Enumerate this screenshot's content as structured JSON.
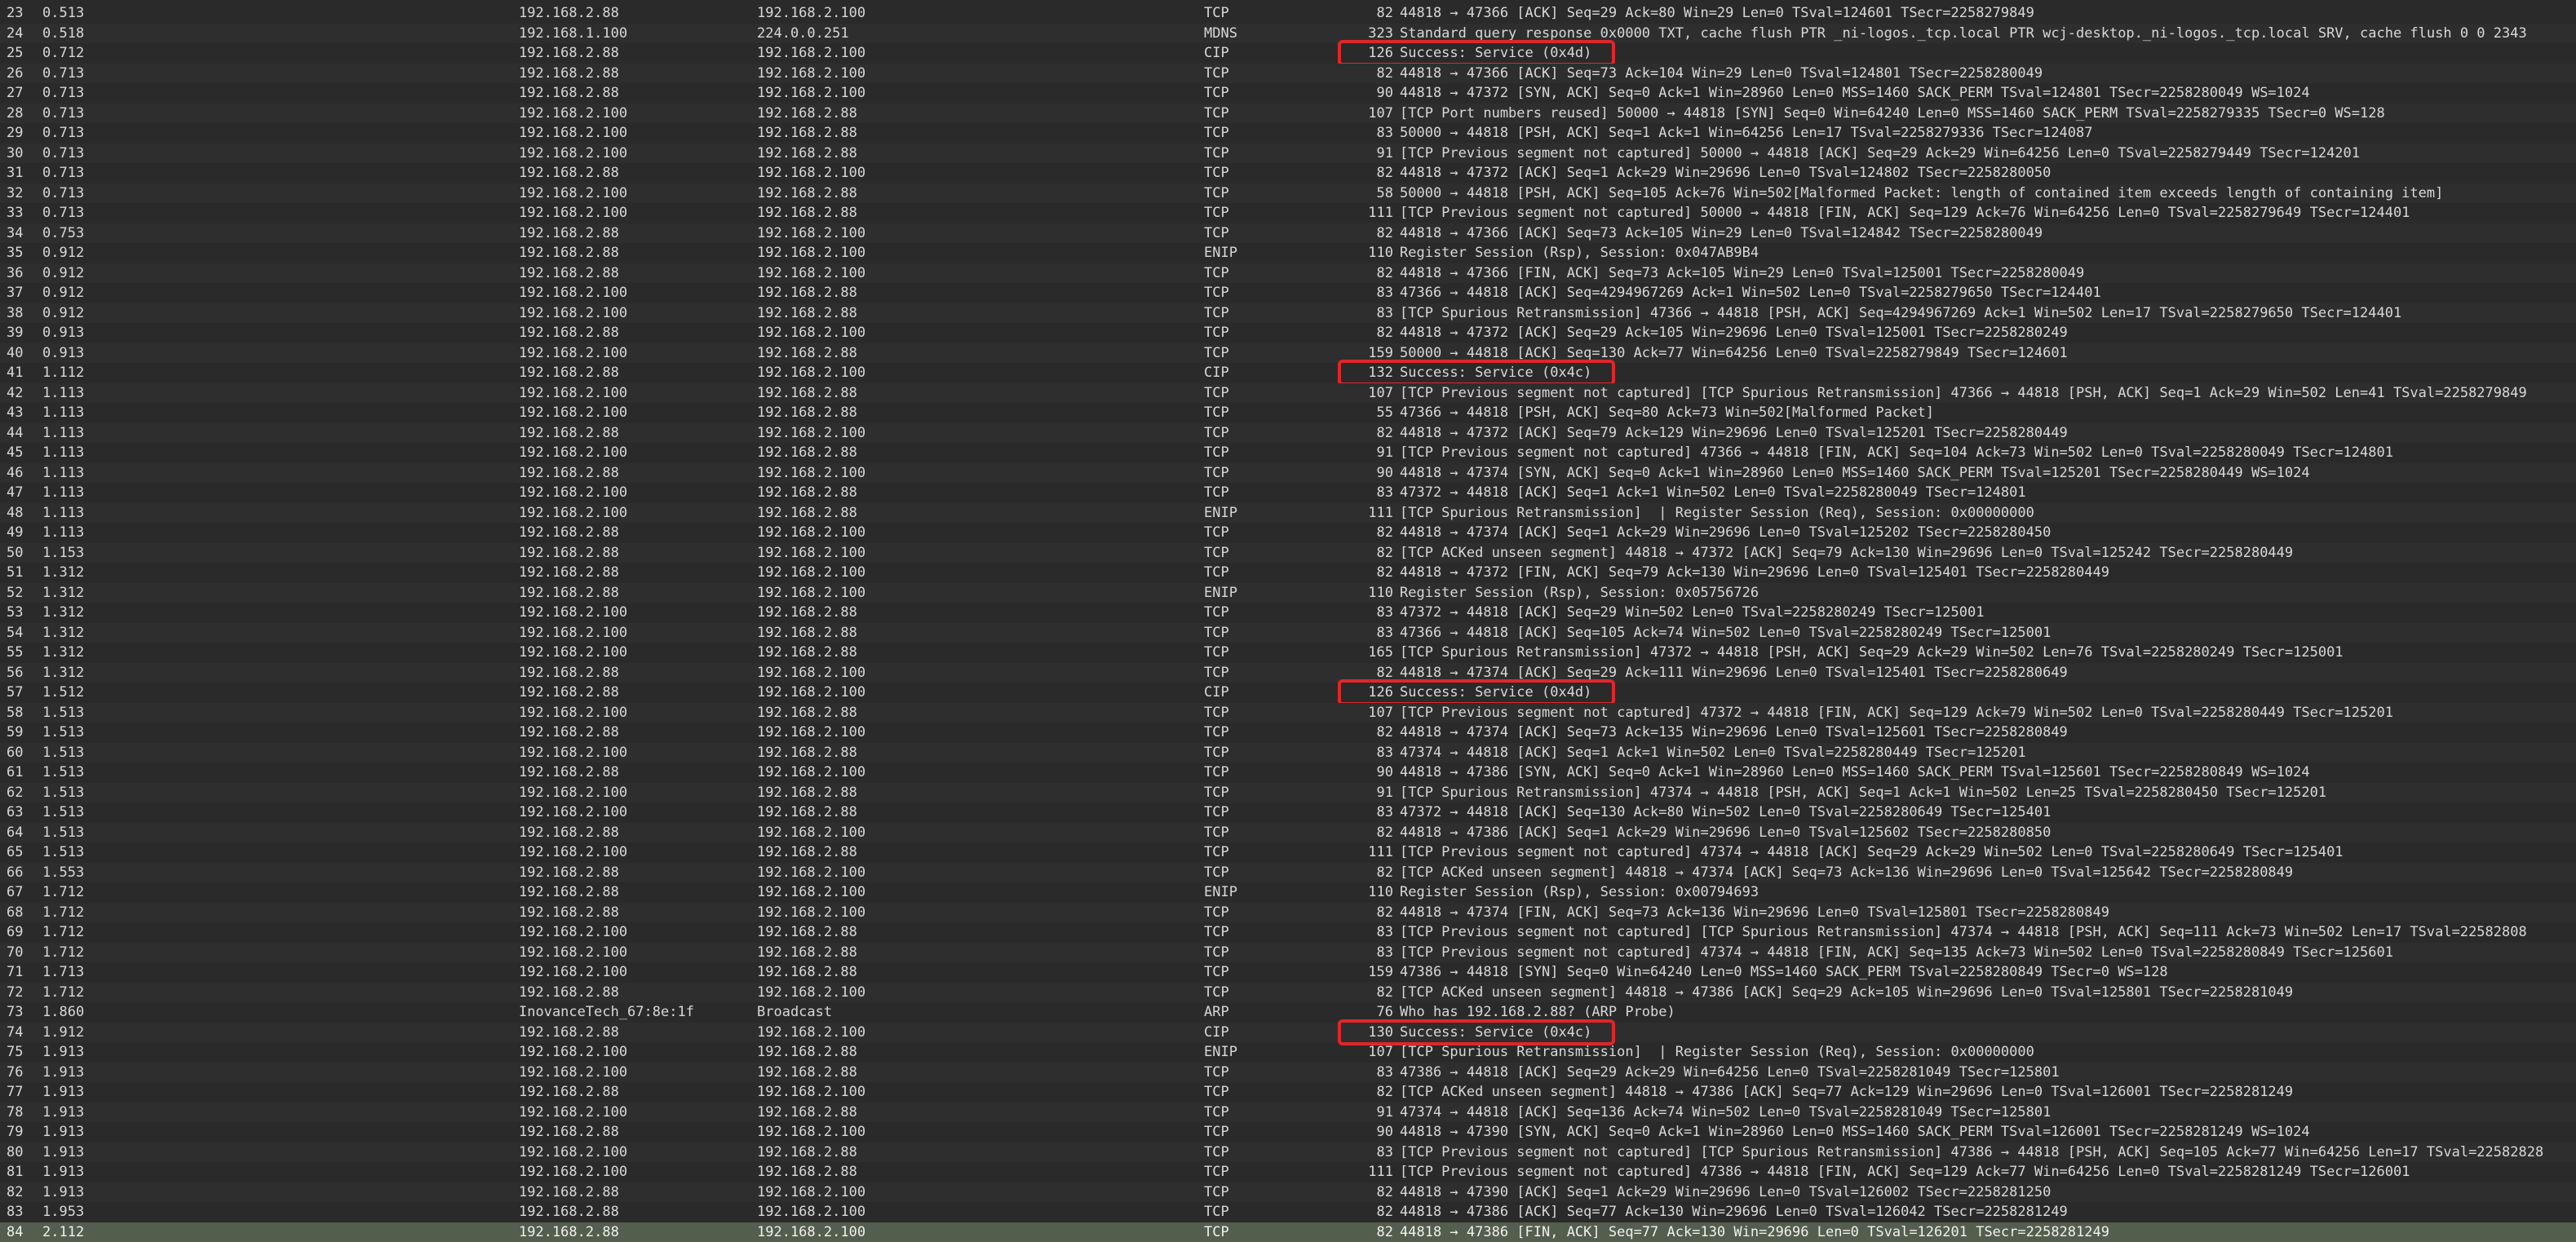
{
  "packets": [
    {
      "no": "23",
      "time": "0.513",
      "src": "192.168.2.88",
      "dst": "192.168.2.100",
      "proto": "TCP",
      "len": "82",
      "info": "44818 → 47366 [ACK] Seq=29 Ack=80 Win=29 Len=0 TSval=124601 TSecr=2258279849"
    },
    {
      "no": "24",
      "time": "0.518",
      "src": "192.168.1.100",
      "dst": "224.0.0.251",
      "proto": "MDNS",
      "len": "323",
      "info": "Standard query response 0x0000 TXT, cache flush PTR _ni-logos._tcp.local PTR wcj-desktop._ni-logos._tcp.local SRV, cache flush 0 0 2343"
    },
    {
      "no": "25",
      "time": "0.712",
      "src": "192.168.2.88",
      "dst": "192.168.2.100",
      "proto": "CIP",
      "len": "126",
      "info": "Success: Service (0x4d)"
    },
    {
      "no": "26",
      "time": "0.713",
      "src": "192.168.2.88",
      "dst": "192.168.2.100",
      "proto": "TCP",
      "len": "82",
      "info": "44818 → 47366 [ACK] Seq=73 Ack=104 Win=29 Len=0 TSval=124801 TSecr=2258280049"
    },
    {
      "no": "27",
      "time": "0.713",
      "src": "192.168.2.88",
      "dst": "192.168.2.100",
      "proto": "TCP",
      "len": "90",
      "info": "44818 → 47372 [SYN, ACK] Seq=0 Ack=1 Win=28960 Len=0 MSS=1460 SACK_PERM TSval=124801 TSecr=2258280049 WS=1024"
    },
    {
      "no": "28",
      "time": "0.713",
      "src": "192.168.2.100",
      "dst": "192.168.2.88",
      "proto": "TCP",
      "len": "107",
      "info": "[TCP Port numbers reused] 50000 → 44818 [SYN] Seq=0 Win=64240 Len=0 MSS=1460 SACK_PERM TSval=2258279335 TSecr=0 WS=128"
    },
    {
      "no": "29",
      "time": "0.713",
      "src": "192.168.2.100",
      "dst": "192.168.2.88",
      "proto": "TCP",
      "len": "83",
      "info": "50000 → 44818 [PSH, ACK] Seq=1 Ack=1 Win=64256 Len=17 TSval=2258279336 TSecr=124087"
    },
    {
      "no": "30",
      "time": "0.713",
      "src": "192.168.2.100",
      "dst": "192.168.2.88",
      "proto": "TCP",
      "len": "91",
      "info": "[TCP Previous segment not captured] 50000 → 44818 [ACK] Seq=29 Ack=29 Win=64256 Len=0 TSval=2258279449 TSecr=124201"
    },
    {
      "no": "31",
      "time": "0.713",
      "src": "192.168.2.88",
      "dst": "192.168.2.100",
      "proto": "TCP",
      "len": "82",
      "info": "44818 → 47372 [ACK] Seq=1 Ack=29 Win=29696 Len=0 TSval=124802 TSecr=2258280050"
    },
    {
      "no": "32",
      "time": "0.713",
      "src": "192.168.2.100",
      "dst": "192.168.2.88",
      "proto": "TCP",
      "len": "58",
      "info": "50000 → 44818 [PSH, ACK] Seq=105 Ack=76 Win=502[Malformed Packet: length of contained item exceeds length of containing item]"
    },
    {
      "no": "33",
      "time": "0.713",
      "src": "192.168.2.100",
      "dst": "192.168.2.88",
      "proto": "TCP",
      "len": "111",
      "info": "[TCP Previous segment not captured] 50000 → 44818 [FIN, ACK] Seq=129 Ack=76 Win=64256 Len=0 TSval=2258279649 TSecr=124401"
    },
    {
      "no": "34",
      "time": "0.753",
      "src": "192.168.2.88",
      "dst": "192.168.2.100",
      "proto": "TCP",
      "len": "82",
      "info": "44818 → 47366 [ACK] Seq=73 Ack=105 Win=29 Len=0 TSval=124842 TSecr=2258280049"
    },
    {
      "no": "35",
      "time": "0.912",
      "src": "192.168.2.88",
      "dst": "192.168.2.100",
      "proto": "ENIP",
      "len": "110",
      "info": "Register Session (Rsp), Session: 0x047AB9B4"
    },
    {
      "no": "36",
      "time": "0.912",
      "src": "192.168.2.88",
      "dst": "192.168.2.100",
      "proto": "TCP",
      "len": "82",
      "info": "44818 → 47366 [FIN, ACK] Seq=73 Ack=105 Win=29 Len=0 TSval=125001 TSecr=2258280049"
    },
    {
      "no": "37",
      "time": "0.912",
      "src": "192.168.2.100",
      "dst": "192.168.2.88",
      "proto": "TCP",
      "len": "83",
      "info": "47366 → 44818 [ACK] Seq=4294967269 Ack=1 Win=502 Len=0 TSval=2258279650 TSecr=124401"
    },
    {
      "no": "38",
      "time": "0.912",
      "src": "192.168.2.100",
      "dst": "192.168.2.88",
      "proto": "TCP",
      "len": "83",
      "info": "[TCP Spurious Retransmission] 47366 → 44818 [PSH, ACK] Seq=4294967269 Ack=1 Win=502 Len=17 TSval=2258279650 TSecr=124401"
    },
    {
      "no": "39",
      "time": "0.913",
      "src": "192.168.2.88",
      "dst": "192.168.2.100",
      "proto": "TCP",
      "len": "82",
      "info": "44818 → 47372 [ACK] Seq=29 Ack=105 Win=29696 Len=0 TSval=125001 TSecr=2258280249"
    },
    {
      "no": "40",
      "time": "0.913",
      "src": "192.168.2.100",
      "dst": "192.168.2.88",
      "proto": "TCP",
      "len": "159",
      "info": "50000 → 44818 [ACK] Seq=130 Ack=77 Win=64256 Len=0 TSval=2258279849 TSecr=124601"
    },
    {
      "no": "41",
      "time": "1.112",
      "src": "192.168.2.88",
      "dst": "192.168.2.100",
      "proto": "CIP",
      "len": "132",
      "info": "Success: Service (0x4c)"
    },
    {
      "no": "42",
      "time": "1.113",
      "src": "192.168.2.100",
      "dst": "192.168.2.88",
      "proto": "TCP",
      "len": "107",
      "info": "[TCP Previous segment not captured] [TCP Spurious Retransmission] 47366 → 44818 [PSH, ACK] Seq=1 Ack=29 Win=502 Len=41 TSval=2258279849"
    },
    {
      "no": "43",
      "time": "1.113",
      "src": "192.168.2.100",
      "dst": "192.168.2.88",
      "proto": "TCP",
      "len": "55",
      "info": "47366 → 44818 [PSH, ACK] Seq=80 Ack=73 Win=502[Malformed Packet]"
    },
    {
      "no": "44",
      "time": "1.113",
      "src": "192.168.2.88",
      "dst": "192.168.2.100",
      "proto": "TCP",
      "len": "82",
      "info": "44818 → 47372 [ACK] Seq=79 Ack=129 Win=29696 Len=0 TSval=125201 TSecr=2258280449"
    },
    {
      "no": "45",
      "time": "1.113",
      "src": "192.168.2.100",
      "dst": "192.168.2.88",
      "proto": "TCP",
      "len": "91",
      "info": "[TCP Previous segment not captured] 47366 → 44818 [FIN, ACK] Seq=104 Ack=73 Win=502 Len=0 TSval=2258280049 TSecr=124801"
    },
    {
      "no": "46",
      "time": "1.113",
      "src": "192.168.2.88",
      "dst": "192.168.2.100",
      "proto": "TCP",
      "len": "90",
      "info": "44818 → 47374 [SYN, ACK] Seq=0 Ack=1 Win=28960 Len=0 MSS=1460 SACK_PERM TSval=125201 TSecr=2258280449 WS=1024"
    },
    {
      "no": "47",
      "time": "1.113",
      "src": "192.168.2.100",
      "dst": "192.168.2.88",
      "proto": "TCP",
      "len": "83",
      "info": "47372 → 44818 [ACK] Seq=1 Ack=1 Win=502 Len=0 TSval=2258280049 TSecr=124801"
    },
    {
      "no": "48",
      "time": "1.113",
      "src": "192.168.2.100",
      "dst": "192.168.2.88",
      "proto": "ENIP",
      "len": "111",
      "info": "[TCP Spurious Retransmission]  | Register Session (Req), Session: 0x00000000"
    },
    {
      "no": "49",
      "time": "1.113",
      "src": "192.168.2.88",
      "dst": "192.168.2.100",
      "proto": "TCP",
      "len": "82",
      "info": "44818 → 47374 [ACK] Seq=1 Ack=29 Win=29696 Len=0 TSval=125202 TSecr=2258280450"
    },
    {
      "no": "50",
      "time": "1.153",
      "src": "192.168.2.88",
      "dst": "192.168.2.100",
      "proto": "TCP",
      "len": "82",
      "info": "[TCP ACKed unseen segment] 44818 → 47372 [ACK] Seq=79 Ack=130 Win=29696 Len=0 TSval=125242 TSecr=2258280449"
    },
    {
      "no": "51",
      "time": "1.312",
      "src": "192.168.2.88",
      "dst": "192.168.2.100",
      "proto": "TCP",
      "len": "82",
      "info": "44818 → 47372 [FIN, ACK] Seq=79 Ack=130 Win=29696 Len=0 TSval=125401 TSecr=2258280449"
    },
    {
      "no": "52",
      "time": "1.312",
      "src": "192.168.2.88",
      "dst": "192.168.2.100",
      "proto": "ENIP",
      "len": "110",
      "info": "Register Session (Rsp), Session: 0x05756726"
    },
    {
      "no": "53",
      "time": "1.312",
      "src": "192.168.2.100",
      "dst": "192.168.2.88",
      "proto": "TCP",
      "len": "83",
      "info": "47372 → 44818 [ACK] Seq=29 Win=502 Len=0 TSval=2258280249 TSecr=125001"
    },
    {
      "no": "54",
      "time": "1.312",
      "src": "192.168.2.100",
      "dst": "192.168.2.88",
      "proto": "TCP",
      "len": "83",
      "info": "47366 → 44818 [ACK] Seq=105 Ack=74 Win=502 Len=0 TSval=2258280249 TSecr=125001"
    },
    {
      "no": "55",
      "time": "1.312",
      "src": "192.168.2.100",
      "dst": "192.168.2.88",
      "proto": "TCP",
      "len": "165",
      "info": "[TCP Spurious Retransmission] 47372 → 44818 [PSH, ACK] Seq=29 Ack=29 Win=502 Len=76 TSval=2258280249 TSecr=125001"
    },
    {
      "no": "56",
      "time": "1.312",
      "src": "192.168.2.88",
      "dst": "192.168.2.100",
      "proto": "TCP",
      "len": "82",
      "info": "44818 → 47374 [ACK] Seq=29 Ack=111 Win=29696 Len=0 TSval=125401 TSecr=2258280649"
    },
    {
      "no": "57",
      "time": "1.512",
      "src": "192.168.2.88",
      "dst": "192.168.2.100",
      "proto": "CIP",
      "len": "126",
      "info": "Success: Service (0x4d)"
    },
    {
      "no": "58",
      "time": "1.513",
      "src": "192.168.2.100",
      "dst": "192.168.2.88",
      "proto": "TCP",
      "len": "107",
      "info": "[TCP Previous segment not captured] 47372 → 44818 [FIN, ACK] Seq=129 Ack=79 Win=502 Len=0 TSval=2258280449 TSecr=125201"
    },
    {
      "no": "59",
      "time": "1.513",
      "src": "192.168.2.88",
      "dst": "192.168.2.100",
      "proto": "TCP",
      "len": "82",
      "info": "44818 → 47374 [ACK] Seq=73 Ack=135 Win=29696 Len=0 TSval=125601 TSecr=2258280849"
    },
    {
      "no": "60",
      "time": "1.513",
      "src": "192.168.2.100",
      "dst": "192.168.2.88",
      "proto": "TCP",
      "len": "83",
      "info": "47374 → 44818 [ACK] Seq=1 Ack=1 Win=502 Len=0 TSval=2258280449 TSecr=125201"
    },
    {
      "no": "61",
      "time": "1.513",
      "src": "192.168.2.88",
      "dst": "192.168.2.100",
      "proto": "TCP",
      "len": "90",
      "info": "44818 → 47386 [SYN, ACK] Seq=0 Ack=1 Win=28960 Len=0 MSS=1460 SACK_PERM TSval=125601 TSecr=2258280849 WS=1024"
    },
    {
      "no": "62",
      "time": "1.513",
      "src": "192.168.2.100",
      "dst": "192.168.2.88",
      "proto": "TCP",
      "len": "91",
      "info": "[TCP Spurious Retransmission] 47374 → 44818 [PSH, ACK] Seq=1 Ack=1 Win=502 Len=25 TSval=2258280450 TSecr=125201"
    },
    {
      "no": "63",
      "time": "1.513",
      "src": "192.168.2.100",
      "dst": "192.168.2.88",
      "proto": "TCP",
      "len": "83",
      "info": "47372 → 44818 [ACK] Seq=130 Ack=80 Win=502 Len=0 TSval=2258280649 TSecr=125401"
    },
    {
      "no": "64",
      "time": "1.513",
      "src": "192.168.2.88",
      "dst": "192.168.2.100",
      "proto": "TCP",
      "len": "82",
      "info": "44818 → 47386 [ACK] Seq=1 Ack=29 Win=29696 Len=0 TSval=125602 TSecr=2258280850"
    },
    {
      "no": "65",
      "time": "1.513",
      "src": "192.168.2.100",
      "dst": "192.168.2.88",
      "proto": "TCP",
      "len": "111",
      "info": "[TCP Previous segment not captured] 47374 → 44818 [ACK] Seq=29 Ack=29 Win=502 Len=0 TSval=2258280649 TSecr=125401"
    },
    {
      "no": "66",
      "time": "1.553",
      "src": "192.168.2.88",
      "dst": "192.168.2.100",
      "proto": "TCP",
      "len": "82",
      "info": "[TCP ACKed unseen segment] 44818 → 47374 [ACK] Seq=73 Ack=136 Win=29696 Len=0 TSval=125642 TSecr=2258280849"
    },
    {
      "no": "67",
      "time": "1.712",
      "src": "192.168.2.88",
      "dst": "192.168.2.100",
      "proto": "ENIP",
      "len": "110",
      "info": "Register Session (Rsp), Session: 0x00794693"
    },
    {
      "no": "68",
      "time": "1.712",
      "src": "192.168.2.88",
      "dst": "192.168.2.100",
      "proto": "TCP",
      "len": "82",
      "info": "44818 → 47374 [FIN, ACK] Seq=73 Ack=136 Win=29696 Len=0 TSval=125801 TSecr=2258280849"
    },
    {
      "no": "69",
      "time": "1.712",
      "src": "192.168.2.100",
      "dst": "192.168.2.88",
      "proto": "TCP",
      "len": "83",
      "info": "[TCP Previous segment not captured] [TCP Spurious Retransmission] 47374 → 44818 [PSH, ACK] Seq=111 Ack=73 Win=502 Len=17 TSval=22582808"
    },
    {
      "no": "70",
      "time": "1.712",
      "src": "192.168.2.100",
      "dst": "192.168.2.88",
      "proto": "TCP",
      "len": "83",
      "info": "[TCP Previous segment not captured] 47374 → 44818 [FIN, ACK] Seq=135 Ack=73 Win=502 Len=0 TSval=2258280849 TSecr=125601"
    },
    {
      "no": "71",
      "time": "1.713",
      "src": "192.168.2.100",
      "dst": "192.168.2.88",
      "proto": "TCP",
      "len": "159",
      "info": "47386 → 44818 [SYN] Seq=0 Win=64240 Len=0 MSS=1460 SACK_PERM TSval=2258280849 TSecr=0 WS=128"
    },
    {
      "no": "72",
      "time": "1.712",
      "src": "192.168.2.88",
      "dst": "192.168.2.100",
      "proto": "TCP",
      "len": "82",
      "info": "[TCP ACKed unseen segment] 44818 → 47386 [ACK] Seq=29 Ack=105 Win=29696 Len=0 TSval=125801 TSecr=2258281049"
    },
    {
      "no": "73",
      "time": "1.860",
      "src": "InovanceTech_67:8e:1f",
      "dst": "Broadcast",
      "proto": "ARP",
      "len": "76",
      "info": "Who has 192.168.2.88? (ARP Probe)"
    },
    {
      "no": "74",
      "time": "1.912",
      "src": "192.168.2.88",
      "dst": "192.168.2.100",
      "proto": "CIP",
      "len": "130",
      "info": "Success: Service (0x4c)"
    },
    {
      "no": "75",
      "time": "1.913",
      "src": "192.168.2.100",
      "dst": "192.168.2.88",
      "proto": "ENIP",
      "len": "107",
      "info": "[TCP Spurious Retransmission]  | Register Session (Req), Session: 0x00000000"
    },
    {
      "no": "76",
      "time": "1.913",
      "src": "192.168.2.100",
      "dst": "192.168.2.88",
      "proto": "TCP",
      "len": "83",
      "info": "47386 → 44818 [ACK] Seq=29 Ack=29 Win=64256 Len=0 TSval=2258281049 TSecr=125801"
    },
    {
      "no": "77",
      "time": "1.913",
      "src": "192.168.2.88",
      "dst": "192.168.2.100",
      "proto": "TCP",
      "len": "82",
      "info": "[TCP ACKed unseen segment] 44818 → 47386 [ACK] Seq=77 Ack=129 Win=29696 Len=0 TSval=126001 TSecr=2258281249"
    },
    {
      "no": "78",
      "time": "1.913",
      "src": "192.168.2.100",
      "dst": "192.168.2.88",
      "proto": "TCP",
      "len": "91",
      "info": "47374 → 44818 [ACK] Seq=136 Ack=74 Win=502 Len=0 TSval=2258281049 TSecr=125801"
    },
    {
      "no": "79",
      "time": "1.913",
      "src": "192.168.2.88",
      "dst": "192.168.2.100",
      "proto": "TCP",
      "len": "90",
      "info": "44818 → 47390 [SYN, ACK] Seq=0 Ack=1 Win=28960 Len=0 MSS=1460 SACK_PERM TSval=126001 TSecr=2258281249 WS=1024"
    },
    {
      "no": "80",
      "time": "1.913",
      "src": "192.168.2.100",
      "dst": "192.168.2.88",
      "proto": "TCP",
      "len": "83",
      "info": "[TCP Previous segment not captured] [TCP Spurious Retransmission] 47386 → 44818 [PSH, ACK] Seq=105 Ack=77 Win=64256 Len=17 TSval=22582828"
    },
    {
      "no": "81",
      "time": "1.913",
      "src": "192.168.2.100",
      "dst": "192.168.2.88",
      "proto": "TCP",
      "len": "111",
      "info": "[TCP Previous segment not captured] 47386 → 44818 [FIN, ACK] Seq=129 Ack=77 Win=64256 Len=0 TSval=2258281249 TSecr=126001"
    },
    {
      "no": "82",
      "time": "1.913",
      "src": "192.168.2.88",
      "dst": "192.168.2.100",
      "proto": "TCP",
      "len": "82",
      "info": "44818 → 47390 [ACK] Seq=1 Ack=29 Win=29696 Len=0 TSval=126002 TSecr=2258281250"
    },
    {
      "no": "83",
      "time": "1.953",
      "src": "192.168.2.88",
      "dst": "192.168.2.100",
      "proto": "TCP",
      "len": "82",
      "info": "44818 → 47386 [ACK] Seq=77 Ack=130 Win=29696 Len=0 TSval=126042 TSecr=2258281249"
    },
    {
      "no": "84",
      "time": "2.112",
      "src": "192.168.2.88",
      "dst": "192.168.2.100",
      "proto": "TCP",
      "len": "82",
      "info": "44818 → 47386 [FIN, ACK] Seq=77 Ack=130 Win=29696 Len=0 TSval=126201 TSecr=2258281249"
    }
  ],
  "selected_packet": "84",
  "highlighted_packets": [
    "25",
    "41",
    "57",
    "74"
  ],
  "colors": {
    "background": "#2a2a2a",
    "text": "#d8d8d8",
    "selected_row": "#535e4c",
    "highlight_box": "#e0262a"
  }
}
